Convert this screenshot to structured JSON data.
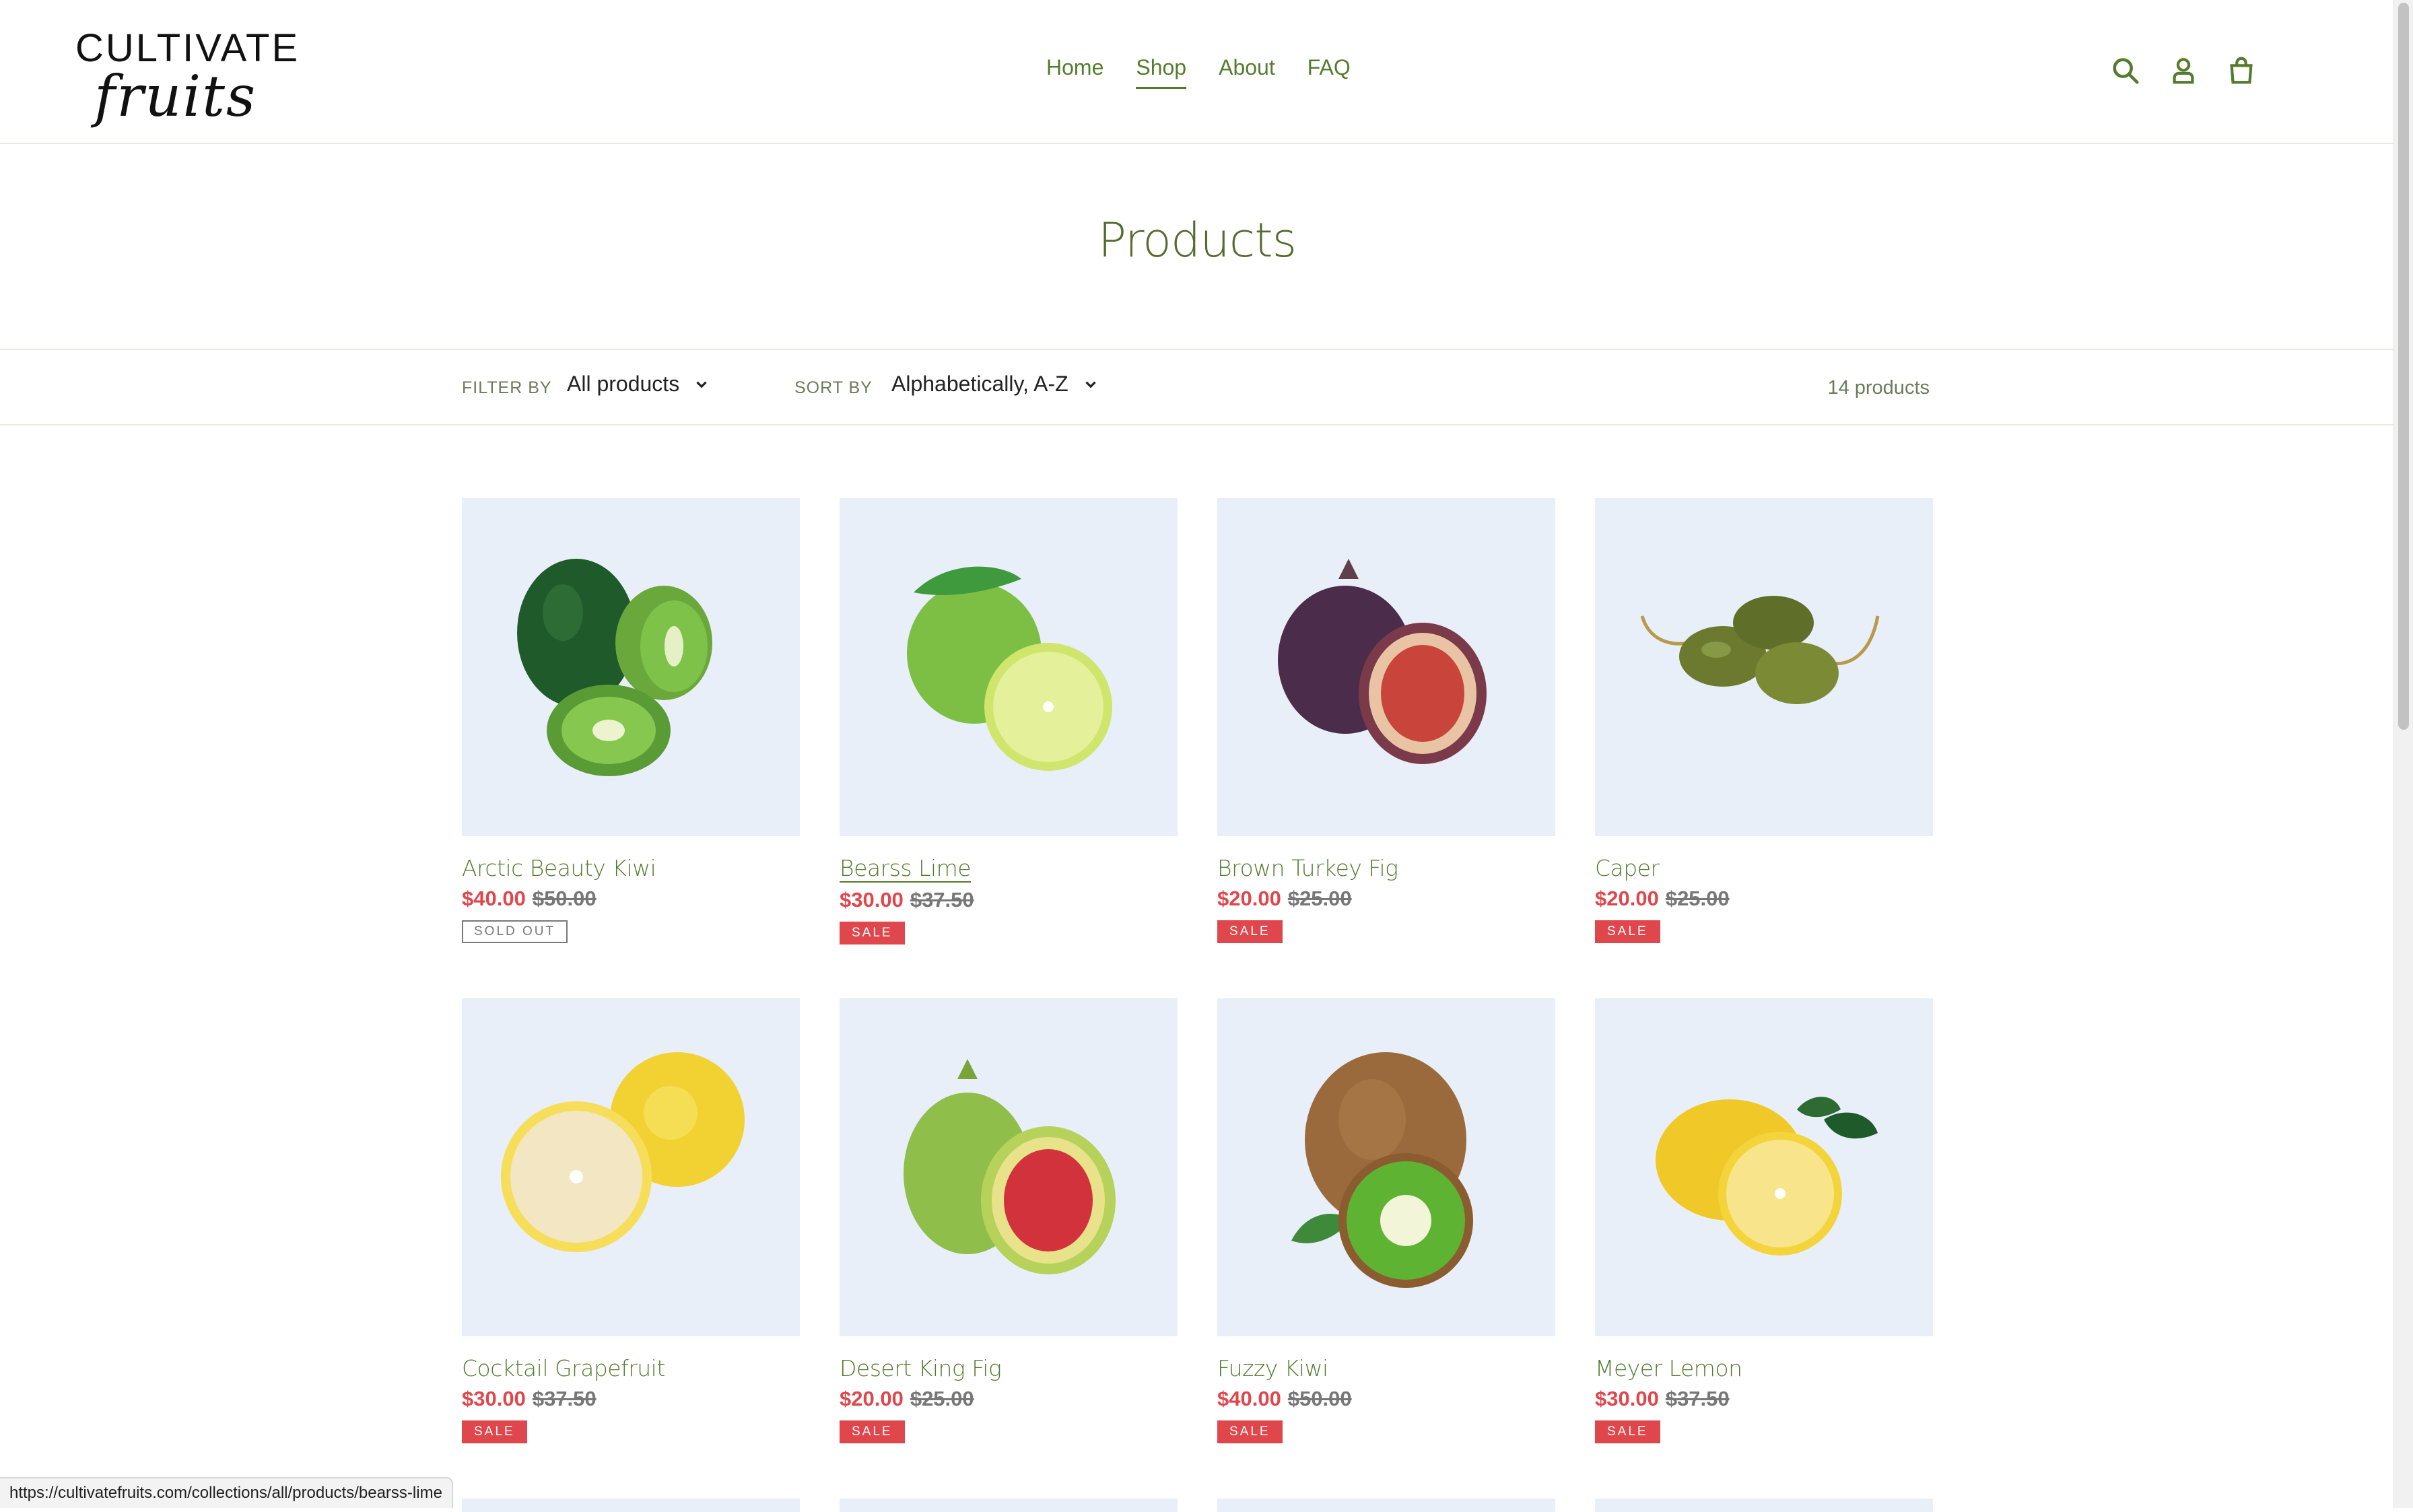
{
  "brand": {
    "line1": "CULTIVATE",
    "line2": "fruits"
  },
  "nav": [
    {
      "label": "Home",
      "active": false
    },
    {
      "label": "Shop",
      "active": true
    },
    {
      "label": "About",
      "active": false
    },
    {
      "label": "FAQ",
      "active": false
    }
  ],
  "header_icons": [
    "search-icon",
    "account-icon",
    "cart-icon"
  ],
  "page_title": "Products",
  "filter": {
    "label": "FILTER BY",
    "value": "All products"
  },
  "sort": {
    "label": "SORT BY",
    "value": "Alphabetically, A-Z"
  },
  "product_count": "14 products",
  "products": [
    {
      "name": "Arctic Beauty Kiwi",
      "sale_price": "$40.00",
      "regular_price": "$50.00",
      "badge": "SOLD OUT",
      "fruit": "kiwi-dark"
    },
    {
      "name": "Bearss Lime",
      "sale_price": "$30.00",
      "regular_price": "$37.50",
      "badge": "SALE",
      "fruit": "lime"
    },
    {
      "name": "Brown Turkey Fig",
      "sale_price": "$20.00",
      "regular_price": "$25.00",
      "badge": "SALE",
      "fruit": "fig-purple"
    },
    {
      "name": "Caper",
      "sale_price": "$20.00",
      "regular_price": "$25.00",
      "badge": "SALE",
      "fruit": "caper"
    },
    {
      "name": "Cocktail Grapefruit",
      "sale_price": "$30.00",
      "regular_price": "$37.50",
      "badge": "SALE",
      "fruit": "grapefruit"
    },
    {
      "name": "Desert King Fig",
      "sale_price": "$20.00",
      "regular_price": "$25.00",
      "badge": "SALE",
      "fruit": "fig-green"
    },
    {
      "name": "Fuzzy Kiwi",
      "sale_price": "$40.00",
      "regular_price": "$50.00",
      "badge": "SALE",
      "fruit": "kiwi-brown"
    },
    {
      "name": "Meyer Lemon",
      "sale_price": "$30.00",
      "regular_price": "$37.50",
      "badge": "SALE",
      "fruit": "lemon"
    }
  ],
  "status_url": "https://cultivatefruits.com/collections/all/products/bearss-lime",
  "colors": {
    "accent": "#557b2f",
    "sale": "#e0474c",
    "thumb_bg": "#e8eff9"
  }
}
